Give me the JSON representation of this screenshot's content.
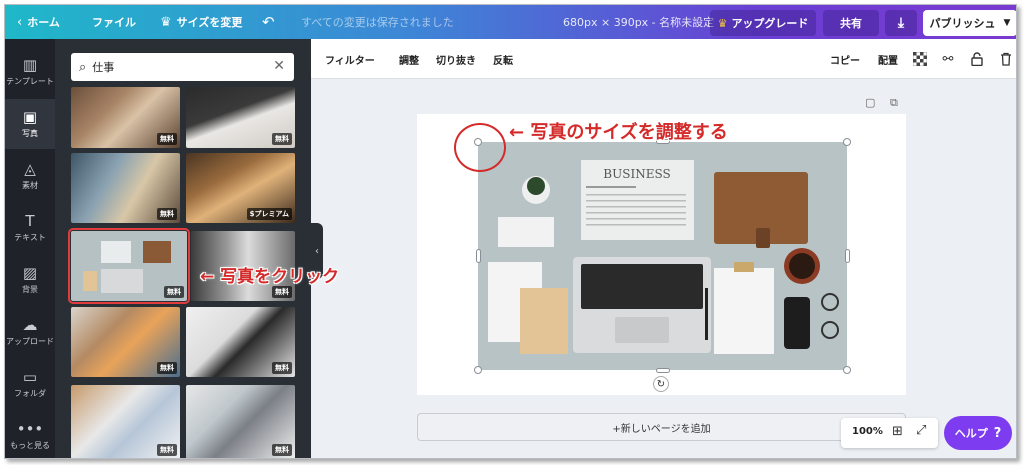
{
  "topbar": {
    "home_icon": "chevron-left-icon",
    "home": "ホーム",
    "file": "ファイル",
    "resize_icon": "crown-icon",
    "resize": "サイズを変更",
    "undo_icon": "undo-icon",
    "status": "すべての変更は保存されました",
    "dimensions": "680px × 390px - 名称未設定",
    "upgrade_icon": "crown-icon",
    "upgrade": "アップグレード",
    "share": "共有",
    "download_icon": "download-icon",
    "publish": "パブリッシュ",
    "publish_chevron_icon": "chevron-down-icon"
  },
  "rail": {
    "items": [
      {
        "label": "テンプレート",
        "icon": "template-icon"
      },
      {
        "label": "写真",
        "icon": "photo-icon"
      },
      {
        "label": "素材",
        "icon": "elements-icon"
      },
      {
        "label": "テキスト",
        "icon": "text-icon"
      },
      {
        "label": "背景",
        "icon": "background-icon"
      },
      {
        "label": "アップロード",
        "icon": "upload-icon"
      },
      {
        "label": "フォルダ",
        "icon": "folder-icon"
      },
      {
        "label": "もっと見る",
        "icon": "more-icon"
      }
    ],
    "active": "写真"
  },
  "panel": {
    "search_value": "仕事",
    "photos": [
      {
        "badge": "無料"
      },
      {
        "badge": "無料"
      },
      {
        "badge": "無料"
      },
      {
        "badge": "$プレミアム"
      },
      {
        "badge": "無料"
      },
      {
        "badge": "無料"
      },
      {
        "badge": "無料"
      },
      {
        "badge": "無料"
      },
      {
        "badge": "無料"
      },
      {
        "badge": "無料"
      }
    ]
  },
  "editor_toolbar": {
    "filter": "フィルター",
    "adjust": "調整",
    "crop": "切り抜き",
    "flip": "反転",
    "copy": "コピー",
    "arrange": "配置"
  },
  "canvas": {
    "newspaper_headline": "BUSINESS",
    "add_page": "+新しいページを追加",
    "zoom": "100%"
  },
  "help": {
    "label": "ヘルプ",
    "mark": "?"
  },
  "annotations": {
    "resize_note": "← 写真のサイズを調整する",
    "click_note": "← 写真をクリック"
  },
  "colors": {
    "accent": "#7d3cf0",
    "annotation": "#d42a2a"
  }
}
